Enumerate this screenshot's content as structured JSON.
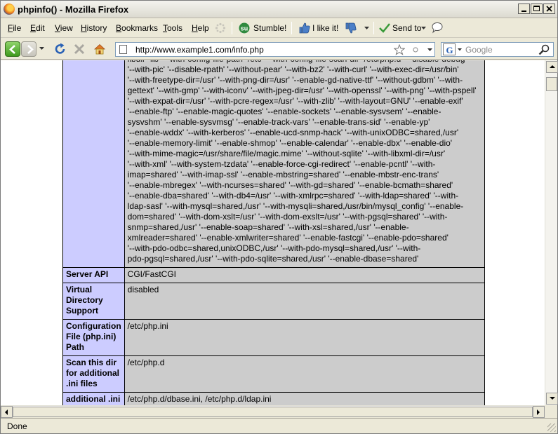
{
  "window": {
    "title": "phpinfo() - Mozilla Firefox"
  },
  "menubar": {
    "items": [
      {
        "label": "File",
        "accel": "F",
        "rest": "ile"
      },
      {
        "label": "Edit",
        "accel": "E",
        "rest": "dit"
      },
      {
        "label": "View",
        "accel": "V",
        "rest": "iew"
      },
      {
        "label": "History",
        "accel": "H",
        "rest": "istory"
      },
      {
        "label": "Bookmarks",
        "accel": "B",
        "rest": "ookmarks"
      },
      {
        "label": "Tools",
        "accel": "T",
        "rest": "ools"
      },
      {
        "label": "Help",
        "accel": "H",
        "rest": "elp"
      }
    ],
    "stumble_label": "Stumble!",
    "ilike_label": "I like it!",
    "sendto_label": "Send to"
  },
  "navbar": {
    "url": "http://www.example1.com/info.php",
    "search_placeholder": "Google"
  },
  "phpinfo": {
    "configure_lines": [
      "libdir=lib' '--with-config-file-path=/etc' '--with-config-file-scan-dir=/etc/php.d' '--disable-debug'",
      "'--with-pic' '--disable-rpath' '--without-pear' '--with-bz2' '--with-curl' '--with-exec-dir=/usr/bin'",
      "'--with-freetype-dir=/usr' '--with-png-dir=/usr' '--enable-gd-native-ttf' '--without-gdbm' '--with-",
      "gettext' '--with-gmp' '--with-iconv' '--with-jpeg-dir=/usr' '--with-openssl' '--with-png' '--with-pspell'",
      "'--with-expat-dir=/usr' '--with-pcre-regex=/usr' '--with-zlib' '--with-layout=GNU' '--enable-exif'",
      "'--enable-ftp' '--enable-magic-quotes' '--enable-sockets' '--enable-sysvsem' '--enable-",
      "sysvshm' '--enable-sysvmsg' '--enable-track-vars' '--enable-trans-sid' '--enable-yp'",
      "'--enable-wddx' '--with-kerberos' '--enable-ucd-snmp-hack' '--with-unixODBC=shared,/usr'",
      "'--enable-memory-limit' '--enable-shmop' '--enable-calendar' '--enable-dbx' '--enable-dio'",
      "'--with-mime-magic=/usr/share/file/magic.mime' '--without-sqlite' '--with-libxml-dir=/usr'",
      "'--with-xml' '--with-system-tzdata' '--enable-force-cgi-redirect' '--enable-pcntl' '--with-",
      "imap=shared' '--with-imap-ssl' '--enable-mbstring=shared' '--enable-mbstr-enc-trans'",
      "'--enable-mbregex' '--with-ncurses=shared' '--with-gd=shared' '--enable-bcmath=shared'",
      "'--enable-dba=shared' '--with-db4=/usr' '--with-xmlrpc=shared' '--with-ldap=shared' '--with-",
      "ldap-sasl' '--with-mysql=shared,/usr' '--with-mysqli=shared,/usr/bin/mysql_config' '--enable-",
      "dom=shared' '--with-dom-xslt=/usr' '--with-dom-exslt=/usr' '--with-pgsql=shared' '--with-",
      "snmp=shared,/usr' '--enable-soap=shared' '--with-xsl=shared,/usr' '--enable-",
      "xmlreader=shared' '--enable-xmlwriter=shared' '--enable-fastcgi' '--enable-pdo=shared'",
      "'--with-pdo-odbc=shared,unixODBC,/usr' '--with-pdo-mysql=shared,/usr' '--with-",
      "pdo-pgsql=shared,/usr' '--with-pdo-sqlite=shared,/usr' '--enable-dbase=shared'"
    ],
    "rows": [
      {
        "key": "Server API",
        "value": "CGI/FastCGI"
      },
      {
        "key": "Virtual Directory Support",
        "value": "disabled"
      },
      {
        "key": "Configuration File (php.ini) Path",
        "value": "/etc/php.ini"
      },
      {
        "key": "Scan this dir for additional .ini files",
        "value": "/etc/php.d"
      },
      {
        "key": "additional .ini",
        "value": "/etc/php.d/dbase.ini, /etc/php.d/ldap.ini"
      }
    ]
  },
  "statusbar": {
    "text": "Done"
  }
}
